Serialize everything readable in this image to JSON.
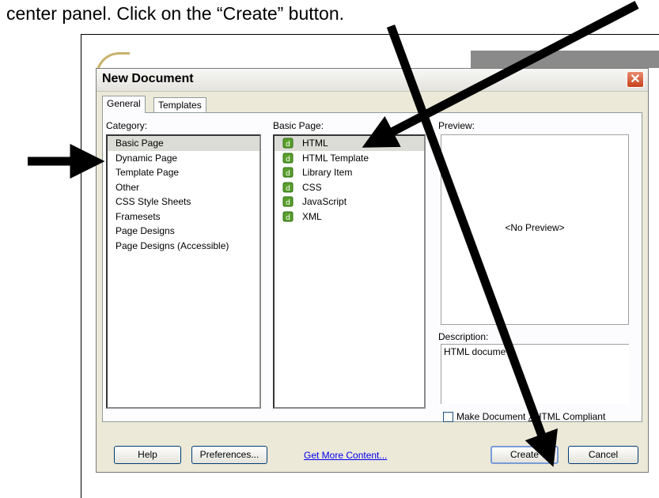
{
  "instruction": {
    "text": "center panel.  Click on the “Create” button."
  },
  "dialog": {
    "title": "New Document",
    "close_glyph": "✕",
    "tabs": [
      {
        "label": "General",
        "active": true
      },
      {
        "label": "Templates",
        "active": false
      }
    ],
    "category": {
      "label": "Category:",
      "items": [
        "Basic Page",
        "Dynamic Page",
        "Template Page",
        "Other",
        "CSS Style Sheets",
        "Framesets",
        "Page Designs",
        "Page Designs (Accessible)"
      ],
      "selected": "Basic Page"
    },
    "basic_page": {
      "label": "Basic Page:",
      "items": [
        "HTML",
        "HTML Template",
        "Library Item",
        "CSS",
        "JavaScript",
        "XML"
      ],
      "selected": "HTML",
      "item_icon": "dreamweaver-doc-icon"
    },
    "preview": {
      "label": "Preview:",
      "placeholder": "<No Preview>"
    },
    "description": {
      "label": "Description:",
      "text": "HTML docume"
    },
    "xhtml_checkbox": {
      "label_before": "Make Document ",
      "mnemonic": "X",
      "label_after": "HTML Compliant",
      "checked": false
    },
    "buttons": {
      "help": "Help",
      "preferences": "Preferences...",
      "get_more": "Get More Content...",
      "create": "Create",
      "cancel": "Cancel"
    }
  },
  "colors": {
    "dialog_bg": "#ece9d8",
    "selection": "#dcdcd6",
    "close_button": "#c8421c",
    "link": "#0000ee",
    "arrow": "#000000"
  }
}
